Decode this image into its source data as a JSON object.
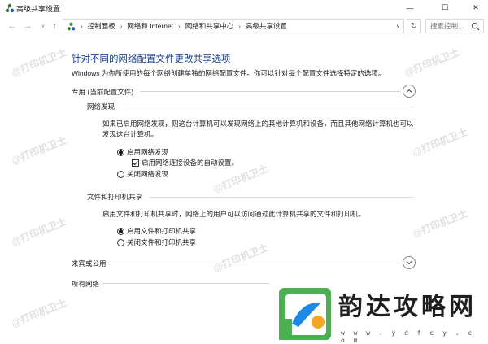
{
  "window": {
    "title": "高级共享设置",
    "minimize_glyph": "—",
    "maximize_glyph": "☐",
    "close_glyph": "✕"
  },
  "address_bar": {
    "back_glyph": "←",
    "forward_glyph": "→",
    "dropdown_glyph": "∨",
    "up_glyph": "↑",
    "breadcrumbs": [
      "控制面板",
      "网络和 Internet",
      "网络和共享中心",
      "高级共享设置"
    ],
    "separator": "›",
    "refresh_glyph": "↻",
    "search_placeholder": "搜索控制..."
  },
  "page": {
    "heading": "针对不同的网络配置文件更改共享选项",
    "description": "Windows 为你所使用的每个网络创建单独的网络配置文件。你可以针对每个配置文件选择特定的选项。"
  },
  "private_profile": {
    "title": "专用 (当前配置文件)",
    "expanded": true,
    "network_discovery": {
      "title": "网络发现",
      "description": "如果已启用网络发现，则这台计算机可以发现网络上的其他计算机和设备，而且其他网络计算机也可以发现这台计算机。",
      "option_on": "启用网络发现",
      "option_auto": "启用网络连接设备的自动设置。",
      "option_off": "关闭网络发现",
      "selected": "on",
      "auto_setup_checked": true
    },
    "file_printer_sharing": {
      "title": "文件和打印机共享",
      "description": "启用文件和打印机共享时，网络上的用户可以访问通过此计算机共享的文件和打印机。",
      "option_on": "启用文件和打印机共享",
      "option_off": "关闭文件和打印机共享",
      "selected": "on"
    }
  },
  "guest_profile": {
    "title": "来宾或公用",
    "expanded": false
  },
  "all_networks": {
    "title": "所有网络"
  },
  "watermark": {
    "text": "@打印机卫士"
  },
  "overlay_logo": {
    "name": "韵达攻略网",
    "url": "w w w . y d f c y . c o m"
  },
  "colors": {
    "heading": "#1a3f8a",
    "logo_green": "#4caf50",
    "logo_blue": "#1e88e5",
    "logo_orange": "#f5a623"
  }
}
